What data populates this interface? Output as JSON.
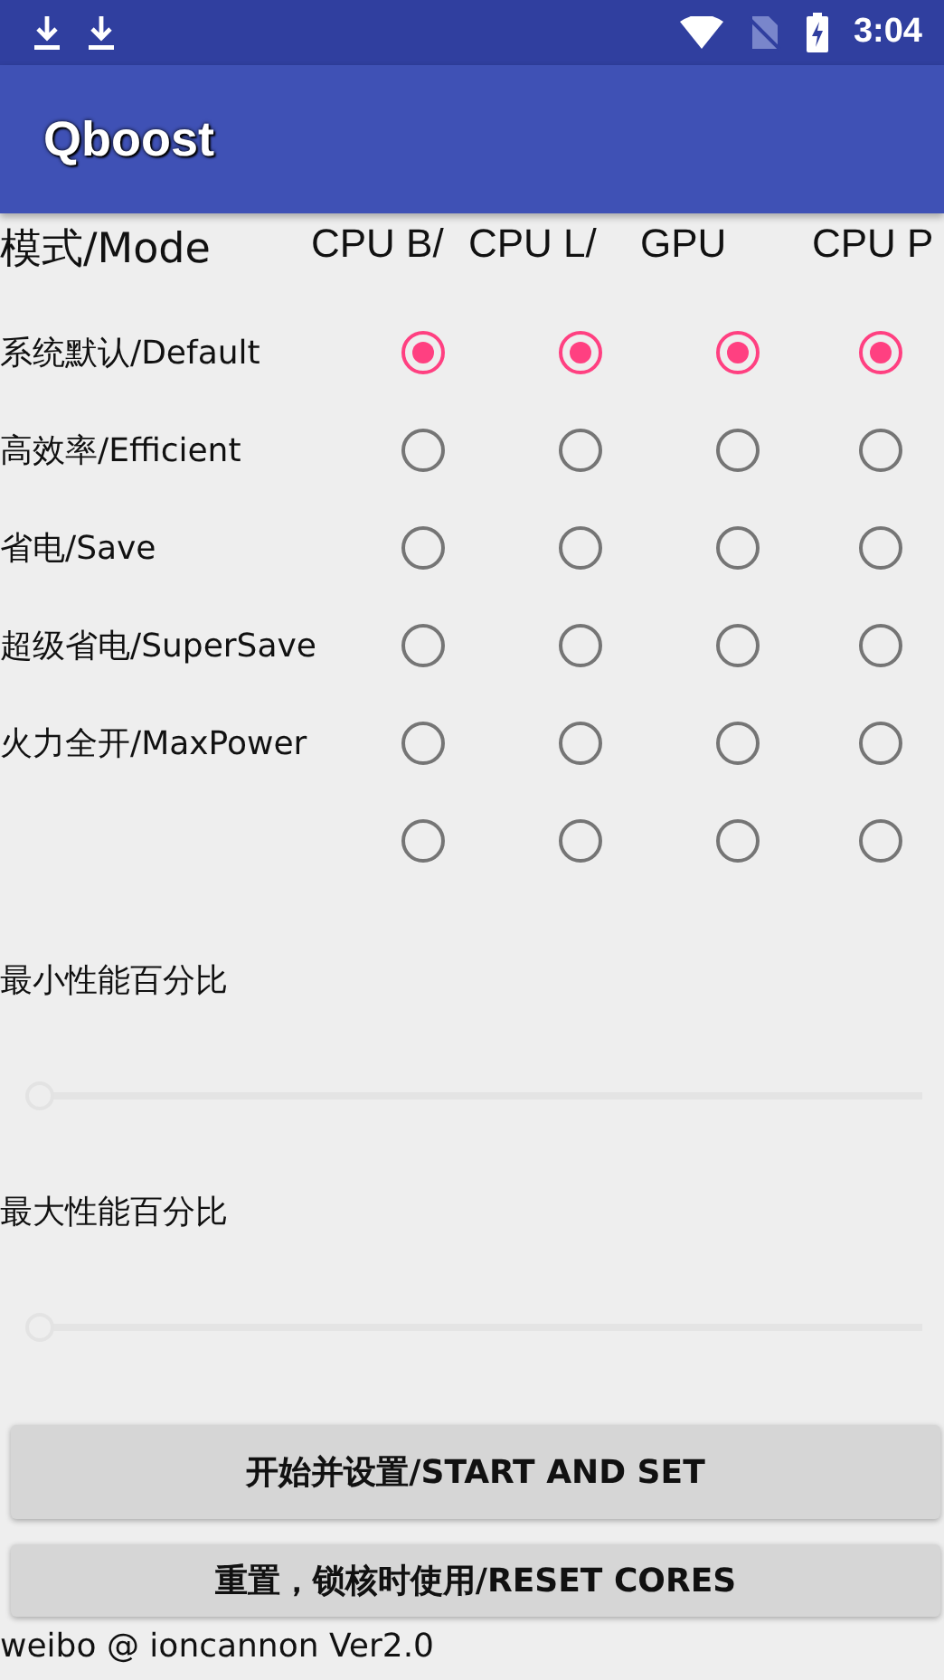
{
  "status_bar": {
    "time": "3:04"
  },
  "app_bar": {
    "title": "Qboost"
  },
  "mode_table": {
    "heading": "模式/Mode",
    "columns": [
      {
        "label": "CPU B/"
      },
      {
        "label": "CPU L/"
      },
      {
        "label": "GPU"
      },
      {
        "label": "CPU P"
      }
    ],
    "rows": [
      {
        "label": "系统默认/Default",
        "options": [
          {
            "selected": true
          },
          {
            "selected": true
          },
          {
            "selected": true
          },
          {
            "selected": true
          }
        ]
      },
      {
        "label": "高效率/Efficient",
        "options": [
          {
            "selected": false
          },
          {
            "selected": false
          },
          {
            "selected": false
          },
          {
            "selected": false
          }
        ]
      },
      {
        "label": "省电/Save",
        "options": [
          {
            "selected": false
          },
          {
            "selected": false
          },
          {
            "selected": false
          },
          {
            "selected": false
          }
        ]
      },
      {
        "label": "超级省电/SuperSave",
        "options": [
          {
            "selected": false
          },
          {
            "selected": false
          },
          {
            "selected": false
          },
          {
            "selected": false
          }
        ]
      },
      {
        "label": "火力全开/MaxPower",
        "options": [
          {
            "selected": false
          },
          {
            "selected": false
          },
          {
            "selected": false
          },
          {
            "selected": false
          }
        ]
      },
      {
        "options": [
          {
            "selected": false
          },
          {
            "selected": false
          },
          {
            "selected": false
          },
          {
            "selected": false
          }
        ]
      }
    ]
  },
  "sliders": [
    {
      "label": "最小性能百分比",
      "level": 0
    },
    {
      "label": "最大性能百分比",
      "level": 0
    }
  ],
  "buttons": [
    "开始并设置/START AND SET",
    "重置，锁核时使用/RESET CORES"
  ],
  "footer": "weibo @ ioncannon Ver2.0"
}
